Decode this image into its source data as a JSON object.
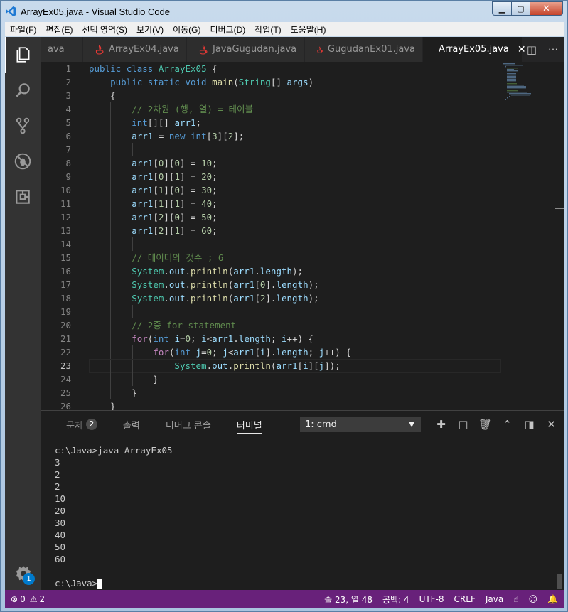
{
  "window": {
    "title": "ArrayEx05.java - Visual Studio Code"
  },
  "menu": [
    "파일(F)",
    "편집(E)",
    "선택 영역(S)",
    "보기(V)",
    "이동(G)",
    "디버그(D)",
    "작업(T)",
    "도움말(H)"
  ],
  "tabs": [
    {
      "label": "ava",
      "active": false,
      "icon": false
    },
    {
      "label": "ArrayEx04.java",
      "active": false,
      "icon": true
    },
    {
      "label": "JavaGugudan.java",
      "active": false,
      "icon": true
    },
    {
      "label": "GugudanEx01.java",
      "active": false,
      "icon": true
    },
    {
      "label": "ArrayEx05.java",
      "active": true,
      "icon": true
    }
  ],
  "editor": {
    "current_line": 23,
    "lines": [
      {
        "n": "1",
        "html": "<span class='kw'>public</span> <span class='kw'>class</span> <span class='ty'>ArrayEx05</span> {"
      },
      {
        "n": "2",
        "html": "    <span class='kw'>public</span> <span class='kw'>static</span> <span class='kw'>void</span> <span class='fn'>main</span>(<span class='ty'>String</span>[] <span class='va'>args</span>)"
      },
      {
        "n": "3",
        "html": "    {"
      },
      {
        "n": "4",
        "html": "        <span class='cm'>// 2차원 (행, 열) = 테이블</span>"
      },
      {
        "n": "5",
        "html": "        <span class='kw'>int</span>[][] <span class='va'>arr1</span>;"
      },
      {
        "n": "6",
        "html": "        <span class='va'>arr1</span> = <span class='kw'>new</span> <span class='kw'>int</span>[<span class='nu'>3</span>][<span class='nu'>2</span>];"
      },
      {
        "n": "7",
        "html": ""
      },
      {
        "n": "8",
        "html": "        <span class='va'>arr1</span>[<span class='nu'>0</span>][<span class='nu'>0</span>] = <span class='nu'>10</span>;"
      },
      {
        "n": "9",
        "html": "        <span class='va'>arr1</span>[<span class='nu'>0</span>][<span class='nu'>1</span>] = <span class='nu'>20</span>;"
      },
      {
        "n": "10",
        "html": "        <span class='va'>arr1</span>[<span class='nu'>1</span>][<span class='nu'>0</span>] = <span class='nu'>30</span>;"
      },
      {
        "n": "11",
        "html": "        <span class='va'>arr1</span>[<span class='nu'>1</span>][<span class='nu'>1</span>] = <span class='nu'>40</span>;"
      },
      {
        "n": "12",
        "html": "        <span class='va'>arr1</span>[<span class='nu'>2</span>][<span class='nu'>0</span>] = <span class='nu'>50</span>;"
      },
      {
        "n": "13",
        "html": "        <span class='va'>arr1</span>[<span class='nu'>2</span>][<span class='nu'>1</span>] = <span class='nu'>60</span>;"
      },
      {
        "n": "14",
        "html": ""
      },
      {
        "n": "15",
        "html": "        <span class='cm'>// 데이터의 갯수 ; 6</span>"
      },
      {
        "n": "16",
        "html": "        <span class='ty'>System</span>.<span class='va'>out</span>.<span class='fn'>println</span>(<span class='va'>arr1</span>.<span class='va'>length</span>);"
      },
      {
        "n": "17",
        "html": "        <span class='ty'>System</span>.<span class='va'>out</span>.<span class='fn'>println</span>(<span class='va'>arr1</span>[<span class='nu'>0</span>].<span class='va'>length</span>);"
      },
      {
        "n": "18",
        "html": "        <span class='ty'>System</span>.<span class='va'>out</span>.<span class='fn'>println</span>(<span class='va'>arr1</span>[<span class='nu'>2</span>].<span class='va'>length</span>);"
      },
      {
        "n": "19",
        "html": ""
      },
      {
        "n": "20",
        "html": "        <span class='cm'>// 2중 for statement</span>"
      },
      {
        "n": "21",
        "html": "        <span class='kc'>for</span>(<span class='kw'>int</span> <span class='va'>i</span>=<span class='nu'>0</span>; <span class='va'>i</span>&lt;<span class='va'>arr1</span>.<span class='va'>length</span>; <span class='va'>i</span>++) {"
      },
      {
        "n": "22",
        "html": "            <span class='kc'>for</span>(<span class='kw'>int</span> <span class='va'>j</span>=<span class='nu'>0</span>; <span class='va'>j</span>&lt;<span class='va'>arr1</span>[<span class='va'>i</span>].<span class='va'>length</span>; <span class='va'>j</span>++) {"
      },
      {
        "n": "23",
        "html": "                <span class='ty'>System</span>.<span class='va'>out</span>.<span class='fn'>println</span>(<span class='va'>arr1</span>[<span class='va'>i</span>][<span class='va'>j</span>]);"
      },
      {
        "n": "24",
        "html": "            }"
      },
      {
        "n": "25",
        "html": "        }"
      },
      {
        "n": "26",
        "html": "    }"
      }
    ]
  },
  "panel": {
    "tabs": [
      {
        "label": "문제",
        "badge": "2",
        "active": false
      },
      {
        "label": "출력",
        "active": false
      },
      {
        "label": "디버그 콘솔",
        "active": false
      },
      {
        "label": "터미널",
        "active": true
      }
    ],
    "terminal_select": "1: cmd",
    "terminal_lines": [
      "c:\\Java>java ArrayEx05",
      "3",
      "2",
      "2",
      "10",
      "20",
      "30",
      "40",
      "50",
      "60",
      ""
    ],
    "prompt": "c:\\Java>"
  },
  "settings_badge": "1",
  "status": {
    "errors": "0",
    "warnings": "2",
    "position": "줄 23, 열 48",
    "spaces": "공백: 4",
    "encoding": "UTF-8",
    "eol": "CRLF",
    "language": "Java"
  },
  "colors": {
    "status_bar": "#68217a",
    "editor_bg": "#1e1e1e",
    "activity_bar": "#333333"
  }
}
